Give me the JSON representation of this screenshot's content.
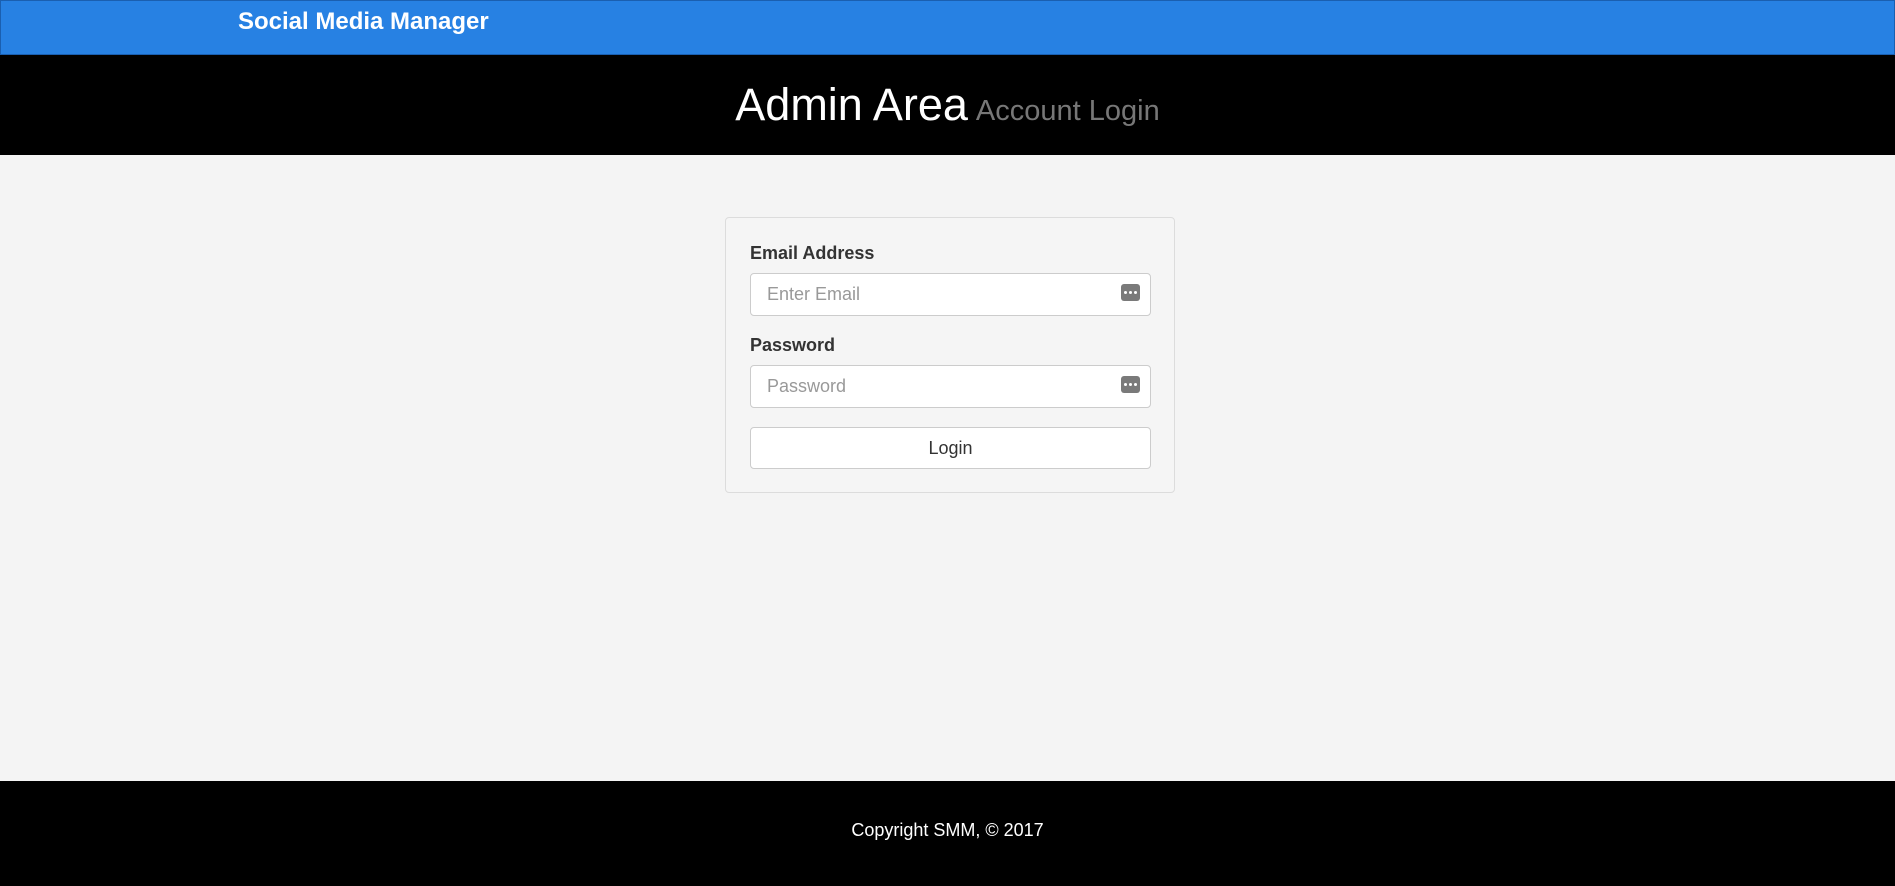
{
  "navbar": {
    "brand": "Social Media Manager",
    "color": "#2781e3"
  },
  "header": {
    "title": "Admin Area",
    "subtitle": "Account Login"
  },
  "login_form": {
    "email": {
      "label": "Email Address",
      "placeholder": "Enter Email",
      "value": "",
      "icon": "password-manager-icon"
    },
    "password": {
      "label": "Password",
      "placeholder": "Password",
      "value": "",
      "icon": "password-manager-icon"
    },
    "submit_label": "Login"
  },
  "footer": {
    "copyright": "Copyright SMM, © 2017"
  }
}
